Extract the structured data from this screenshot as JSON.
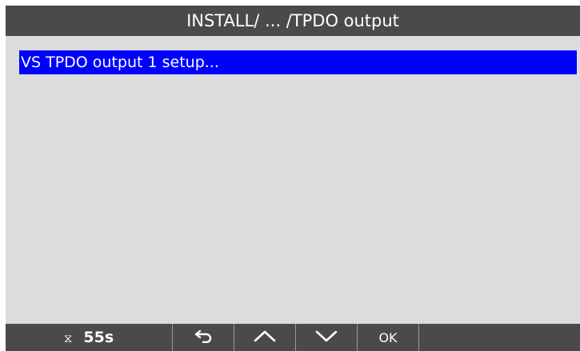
{
  "header": {
    "title": "INSTALL/ ... /TPDO output"
  },
  "menu": {
    "items": [
      {
        "label": "VS TPDO output 1 setup...",
        "selected": true
      }
    ]
  },
  "footer": {
    "timer_icon": "hourglass-icon",
    "timer_value": "55s",
    "back_icon": "return-arrow-icon",
    "up_icon": "chevron-up-icon",
    "down_icon": "chevron-down-icon",
    "ok_label": "OK"
  },
  "colors": {
    "bar_background": "#4a4a4a",
    "screen_background": "#dcdcdc",
    "selection": "#0000ff",
    "text_on_dark": "#ffffff"
  }
}
